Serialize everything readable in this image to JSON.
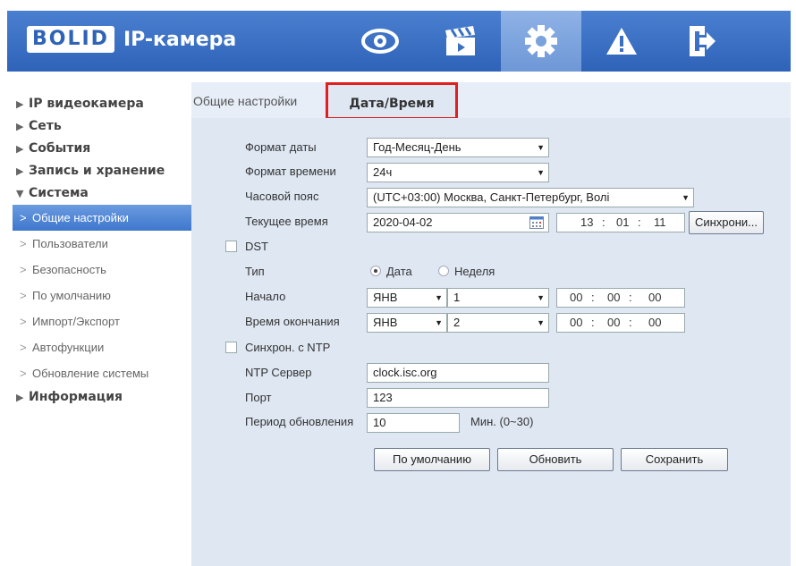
{
  "header": {
    "logo_box": "BOLID",
    "logo_text": "IP-камера",
    "nav": [
      "live-view",
      "playback",
      "settings",
      "alarm",
      "logout"
    ]
  },
  "sidebar": {
    "sections": [
      {
        "label": "IP видеокамера",
        "expanded": false
      },
      {
        "label": "Сеть",
        "expanded": false
      },
      {
        "label": "События",
        "expanded": false
      },
      {
        "label": "Запись и хранение",
        "expanded": false
      },
      {
        "label": "Система",
        "expanded": true
      },
      {
        "label": "Информация",
        "expanded": false
      }
    ],
    "system_items": [
      "Общие настройки",
      "Пользователи",
      "Безопасность",
      "По умолчанию",
      "Импорт/Экспорт",
      "Автофункции",
      "Обновление системы"
    ],
    "active_item": "Общие настройки"
  },
  "tabs": {
    "general": "Общие настройки",
    "datetime": "Дата/Время"
  },
  "form": {
    "date_format_label": "Формат даты",
    "date_format_value": "Год-Месяц-День",
    "time_format_label": "Формат времени",
    "time_format_value": "24ч",
    "timezone_label": "Часовой пояс",
    "timezone_value": "(UTC+03:00) Москва, Санкт-Петербург, Волі",
    "current_time_label": "Текущее время",
    "current_date": "2020-04-02",
    "current_hh": "13",
    "current_mm": "01",
    "current_ss": "11",
    "sync_button": "Синхрони...",
    "dst_label": "DST",
    "type_label": "Тип",
    "type_date": "Дата",
    "type_week": "Неделя",
    "start_label": "Начало",
    "start_month": "ЯНВ",
    "start_day": "1",
    "start_hh": "00",
    "start_mm": "00",
    "start_ss": "00",
    "end_label": "Время окончания",
    "end_month": "ЯНВ",
    "end_day": "2",
    "end_hh": "00",
    "end_mm": "00",
    "end_ss": "00",
    "ntp_sync_label": "Синхрон. с NTP",
    "ntp_server_label": "NTP Сервер",
    "ntp_server_value": "clock.isc.org",
    "port_label": "Порт",
    "port_value": "123",
    "period_label": "Период обновления",
    "period_value": "10",
    "period_unit": "Мин. (0~30)",
    "colon": ":"
  },
  "buttons": {
    "default": "По умолчанию",
    "refresh": "Обновить",
    "save": "Сохранить"
  }
}
